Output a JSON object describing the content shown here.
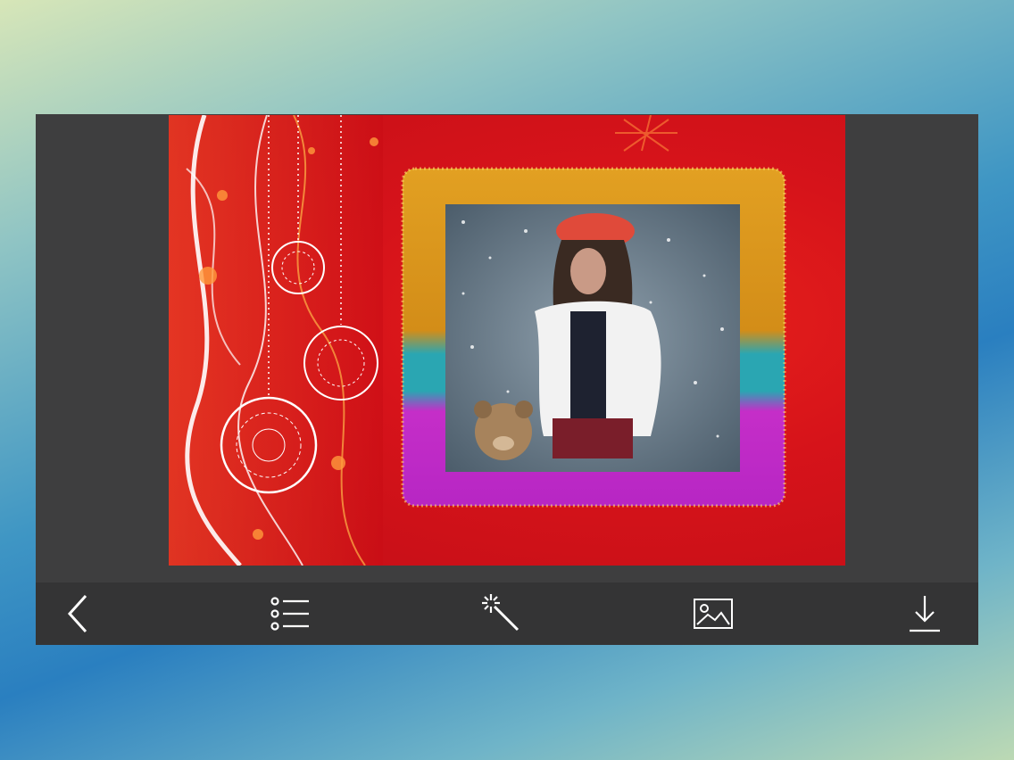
{
  "editor": {
    "toolbar": {
      "back_icon": "chevron-left-icon",
      "frames_icon": "list-icon",
      "effects_icon": "magic-wand-icon",
      "gallery_icon": "image-icon",
      "save_icon": "download-icon"
    },
    "photo": {
      "frame_colors": [
        "#d8991f",
        "#2aa6b2",
        "#c52ec8"
      ],
      "background_color": "#d6131a"
    }
  }
}
